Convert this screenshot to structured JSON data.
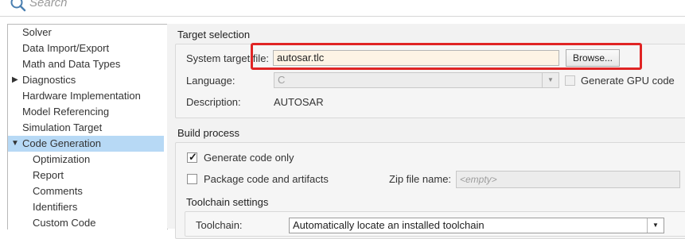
{
  "search": {
    "placeholder": "Search"
  },
  "tree": {
    "items": [
      {
        "label": "Solver"
      },
      {
        "label": "Data Import/Export"
      },
      {
        "label": "Math and Data Types"
      },
      {
        "label": "Diagnostics",
        "expander": "collapsed"
      },
      {
        "label": "Hardware Implementation"
      },
      {
        "label": "Model Referencing"
      },
      {
        "label": "Simulation Target"
      },
      {
        "label": "Code Generation",
        "expander": "expanded",
        "selected": true
      },
      {
        "label": "Optimization"
      },
      {
        "label": "Report"
      },
      {
        "label": "Comments"
      },
      {
        "label": "Identifiers"
      },
      {
        "label": "Custom Code"
      }
    ]
  },
  "target_selection": {
    "title": "Target selection",
    "system_target_file_label": "System target file:",
    "system_target_file_value": "autosar.tlc",
    "browse_label": "Browse...",
    "language_label": "Language:",
    "language_value": "C",
    "gpu_label": "Generate GPU code",
    "description_label": "Description:",
    "description_value": "AUTOSAR"
  },
  "build_process": {
    "title": "Build process",
    "generate_code_only_label": "Generate code only",
    "generate_code_only_checked": true,
    "package_label": "Package code and artifacts",
    "package_checked": false,
    "zip_label": "Zip file name:",
    "zip_placeholder": "<empty>",
    "toolchain_settings_title": "Toolchain settings",
    "toolchain_label": "Toolchain:",
    "toolchain_value": "Automatically locate an installed toolchain"
  },
  "colors": {
    "selection": "#b7d9f5",
    "highlight_box": "#e02424",
    "field_bg": "#fdf3e5"
  }
}
